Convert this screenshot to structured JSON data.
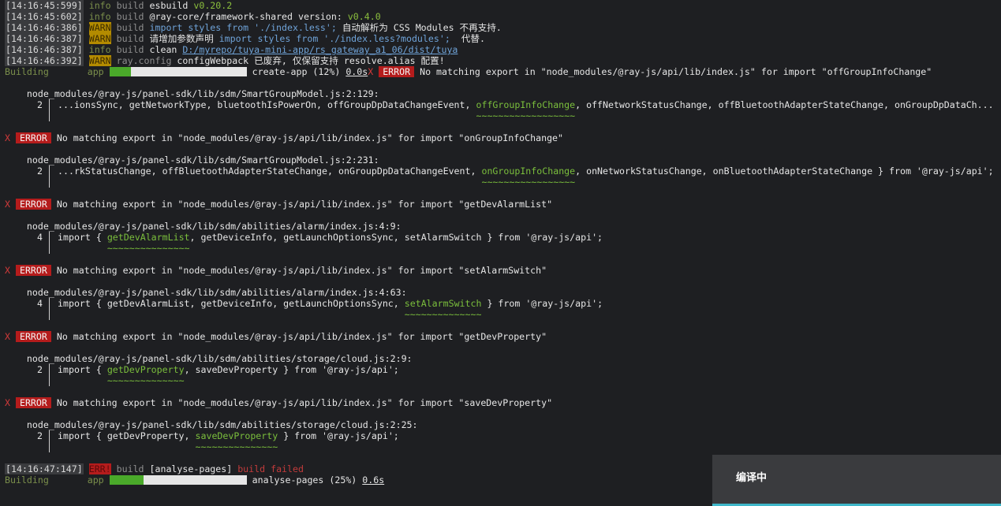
{
  "logs": [
    {
      "ts": "[14:16:45:599]",
      "level": "info",
      "cat": "build",
      "msg": "esbuild ",
      "extra": "v0.20.2"
    },
    {
      "ts": "[14:16:45:602]",
      "level": "info",
      "cat": "build",
      "msg": "@ray-core/framework-shared version: ",
      "extra": "v0.4.0"
    },
    {
      "ts": "[14:16:46:386]",
      "level": "WARN",
      "cat": "build",
      "code": "import styles from './index.less';",
      "msg": " 自动解析为 CSS Modules 不再支持."
    },
    {
      "ts": "[14:16:46:387]",
      "level": "WARN",
      "cat": "build",
      "msg": "请增加参数声明 ",
      "code": "import styles from './index.less?modules';",
      "msg2": "  代替."
    },
    {
      "ts": "[14:16:46:387]",
      "level": "info",
      "cat": "build",
      "msg": "clean ",
      "path": "D:/myrepo/tuya-mini-app/rs_gateway_a1_06/dist/tuya"
    },
    {
      "ts": "[14:16:46:392]",
      "level": "WARN",
      "cat": "ray.config",
      "msg": "configWebpack 已废弃, 仅保留支持 resolve.alias 配置!"
    }
  ],
  "building1": {
    "label": "Building",
    "app": "app",
    "progress": 0.16,
    "task": "create-app (12%)",
    "time": "0.0s",
    "x": "X",
    "badge": "ERROR",
    "msg": "No matching export in \"node_modules/@ray-js/api/lib/index.js\" for import \"offGroupInfoChange\""
  },
  "errors": [
    {
      "file": "node_modules/@ray-js/panel-sdk/lib/sdm/SmartGroupModel.js:2:129:",
      "lnum": "2",
      "pre": "...ionsSync, getNetworkType, bluetoothIsPowerOn, offGroupDpDataChangeEvent, ",
      "hl": "offGroupInfoChange",
      "post": ", offNetworkStatusChange, offBluetoothAdapterStateChange, onGroupDpDataCh...",
      "tilde": "~~~~~~~~~~~~~~~~~~"
    },
    {
      "x": "X",
      "badge": "ERROR",
      "msg": "No matching export in \"node_modules/@ray-js/api/lib/index.js\" for import \"onGroupInfoChange\"",
      "file": "node_modules/@ray-js/panel-sdk/lib/sdm/SmartGroupModel.js:2:231:",
      "lnum": "2",
      "pre": "...rkStatusChange, offBluetoothAdapterStateChange, onGroupDpDataChangeEvent, ",
      "hl": "onGroupInfoChange",
      "post": ", onNetworkStatusChange, onBluetoothAdapterStateChange } from '@ray-js/api';",
      "tilde": "~~~~~~~~~~~~~~~~~"
    },
    {
      "x": "X",
      "badge": "ERROR",
      "msg": "No matching export in \"node_modules/@ray-js/api/lib/index.js\" for import \"getDevAlarmList\"",
      "file": "node_modules/@ray-js/panel-sdk/lib/sdm/abilities/alarm/index.js:4:9:",
      "lnum": "4",
      "pre": "import { ",
      "hl": "getDevAlarmList",
      "post": ", getDeviceInfo, getLaunchOptionsSync, setAlarmSwitch } from '@ray-js/api';",
      "tilde": "~~~~~~~~~~~~~~~"
    },
    {
      "x": "X",
      "badge": "ERROR",
      "msg": "No matching export in \"node_modules/@ray-js/api/lib/index.js\" for import \"setAlarmSwitch\"",
      "file": "node_modules/@ray-js/panel-sdk/lib/sdm/abilities/alarm/index.js:4:63:",
      "lnum": "4",
      "pre": "import { getDevAlarmList, getDeviceInfo, getLaunchOptionsSync, ",
      "hl": "setAlarmSwitch",
      "post": " } from '@ray-js/api';",
      "tilde": "~~~~~~~~~~~~~~"
    },
    {
      "x": "X",
      "badge": "ERROR",
      "msg": "No matching export in \"node_modules/@ray-js/api/lib/index.js\" for import \"getDevProperty\"",
      "file": "node_modules/@ray-js/panel-sdk/lib/sdm/abilities/storage/cloud.js:2:9:",
      "lnum": "2",
      "pre": "import { ",
      "hl": "getDevProperty",
      "post": ", saveDevProperty } from '@ray-js/api';",
      "tilde": "~~~~~~~~~~~~~~"
    },
    {
      "x": "X",
      "badge": "ERROR",
      "msg": "No matching export in \"node_modules/@ray-js/api/lib/index.js\" for import \"saveDevProperty\"",
      "file": "node_modules/@ray-js/panel-sdk/lib/sdm/abilities/storage/cloud.js:2:25:",
      "lnum": "2",
      "pre": "import { getDevProperty, ",
      "hl": "saveDevProperty",
      "post": " } from '@ray-js/api';",
      "tilde": "~~~~~~~~~~~~~~~"
    }
  ],
  "final": {
    "ts": "[14:16:47:147]",
    "level": "ERR!",
    "cat": "build",
    "msg": "[analyse-pages] ",
    "fail": "build failed"
  },
  "building2": {
    "label": "Building",
    "app": "app",
    "progress": 0.25,
    "task": "analyse-pages (25%)",
    "time": "0.6s"
  },
  "toast": {
    "label": "编译中"
  },
  "colors": {
    "accent": "#3fb7c9",
    "error": "#b51c1c",
    "warn": "#b38b00",
    "ok": "#4aa92a"
  }
}
